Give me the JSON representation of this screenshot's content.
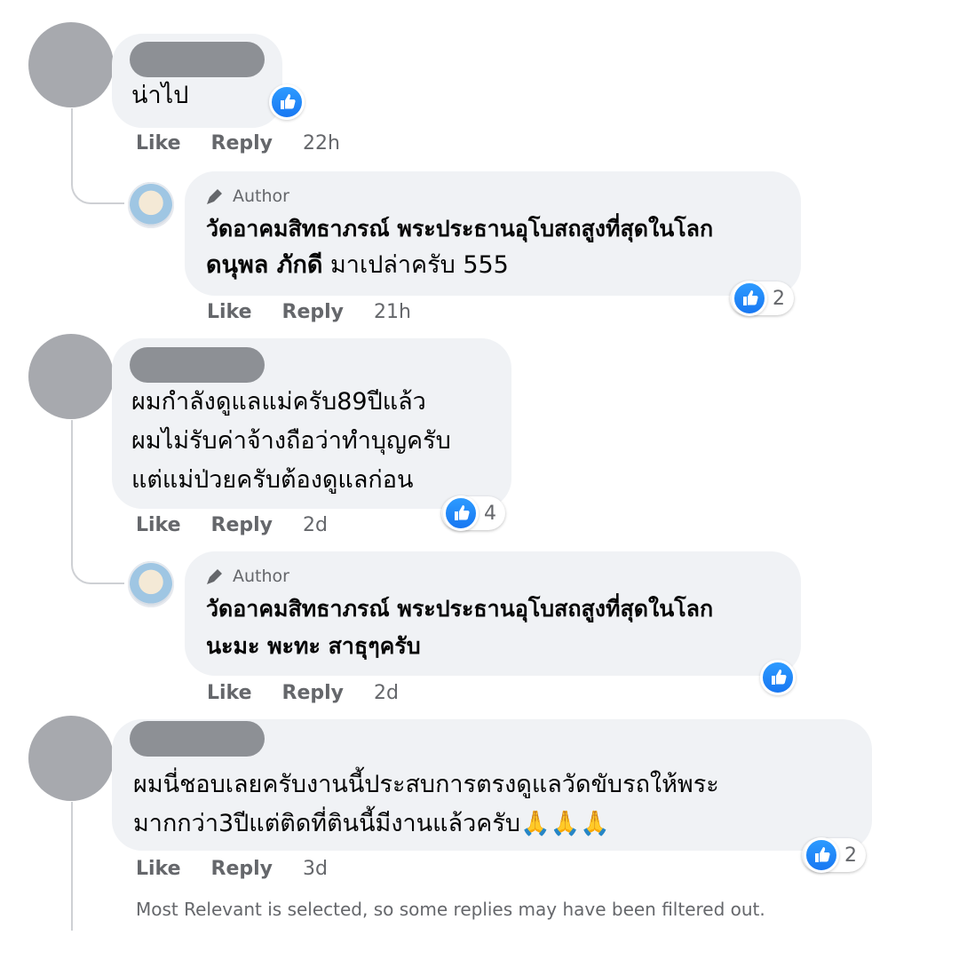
{
  "like_icon": "thumbs-up-icon",
  "accent_color": "#1877f2",
  "author_badge_icon": "pencil-icon",
  "comments": [
    {
      "text": "น่าไป",
      "actions": {
        "like": "Like",
        "reply": "Reply",
        "time": "22h"
      },
      "reply": {
        "badge": "Author",
        "name": "วัดอาคมสิทธาภรณ์ พระประธานอุโบสถสูงที่สุดในโลก",
        "mention": "ดนุพล ภักดี",
        "text": " มาเปล่าครับ 555",
        "reaction_count": "2",
        "actions": {
          "like": "Like",
          "reply": "Reply",
          "time": "21h"
        }
      }
    },
    {
      "lines": [
        "ผมกำลังดูแลแม่ครับ89ปีแล้ว",
        "ผมไม่รับค่าจ้างถือว่าทำบุญครับ",
        "แต่แม่ป่วยครับต้องดูแลก่อน"
      ],
      "reaction_count": "4",
      "actions": {
        "like": "Like",
        "reply": "Reply",
        "time": "2d"
      },
      "reply": {
        "badge": "Author",
        "name": "วัดอาคมสิทธาภรณ์ พระประธานอุโบสถสูงที่สุดในโลก",
        "text": "นะมะ พะทะ สาธุๆครับ",
        "actions": {
          "like": "Like",
          "reply": "Reply",
          "time": "2d"
        }
      }
    },
    {
      "lines": [
        "ผมนี่ชอบเลยครับงานนี้ประสบการตรงดูแลวัดขับรถให้พระ",
        "มากกว่า3ปีแต่ติดที่ตินนี้มีงานแล้วครับ"
      ],
      "emoji": "🙏🙏🙏",
      "reaction_count": "2",
      "actions": {
        "like": "Like",
        "reply": "Reply",
        "time": "3d"
      }
    }
  ],
  "footer_note": "Most Relevant is selected, so some replies may have been filtered out."
}
